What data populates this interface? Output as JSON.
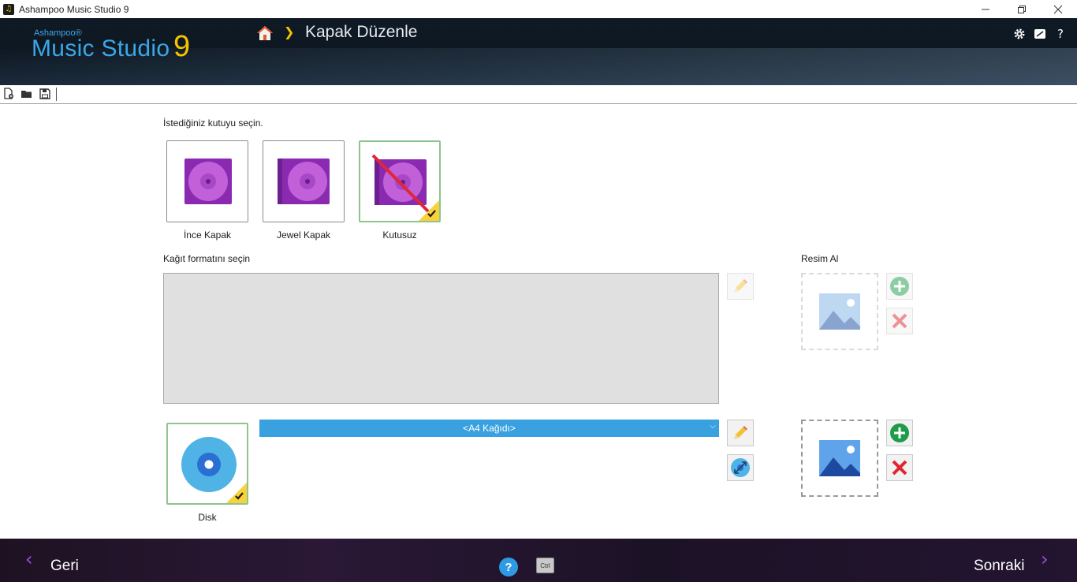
{
  "window": {
    "title": "Ashampoo Music Studio 9",
    "minimize_icon": "minimize-icon",
    "restore_icon": "restore-icon",
    "close_icon": "close-icon"
  },
  "header": {
    "brand_small": "Ashampoo®",
    "brand_main": "Music Studio",
    "brand_version": "9",
    "breadcrumb_page": "Kapak Düzenle"
  },
  "toolbar": {
    "icons": [
      "new-document-icon",
      "open-folder-icon",
      "save-icon"
    ]
  },
  "box_selection": {
    "prompt": "İstediğiniz kutuyu seçin.",
    "options": [
      {
        "label": "İnce Kapak",
        "selected": false
      },
      {
        "label": "Jewel Kapak",
        "selected": false
      },
      {
        "label": "Kutusuz",
        "selected": true
      }
    ]
  },
  "paper": {
    "prompt": "Kağıt formatını seçin",
    "format_value": "<A4 Kağıdı>"
  },
  "disc": {
    "label": "Disk",
    "selected": true
  },
  "image": {
    "label": "Resim Al"
  },
  "footer": {
    "back_label": "Geri",
    "next_label": "Sonraki",
    "help_label": "?",
    "ctrl_label": "Ctrl"
  },
  "colors": {
    "accent_blue": "#3aa1e0",
    "brand_yellow": "#f5c400",
    "nav_purple": "#9b4fd6",
    "add_green": "#1e9c4a",
    "remove_red": "#e0262f"
  }
}
